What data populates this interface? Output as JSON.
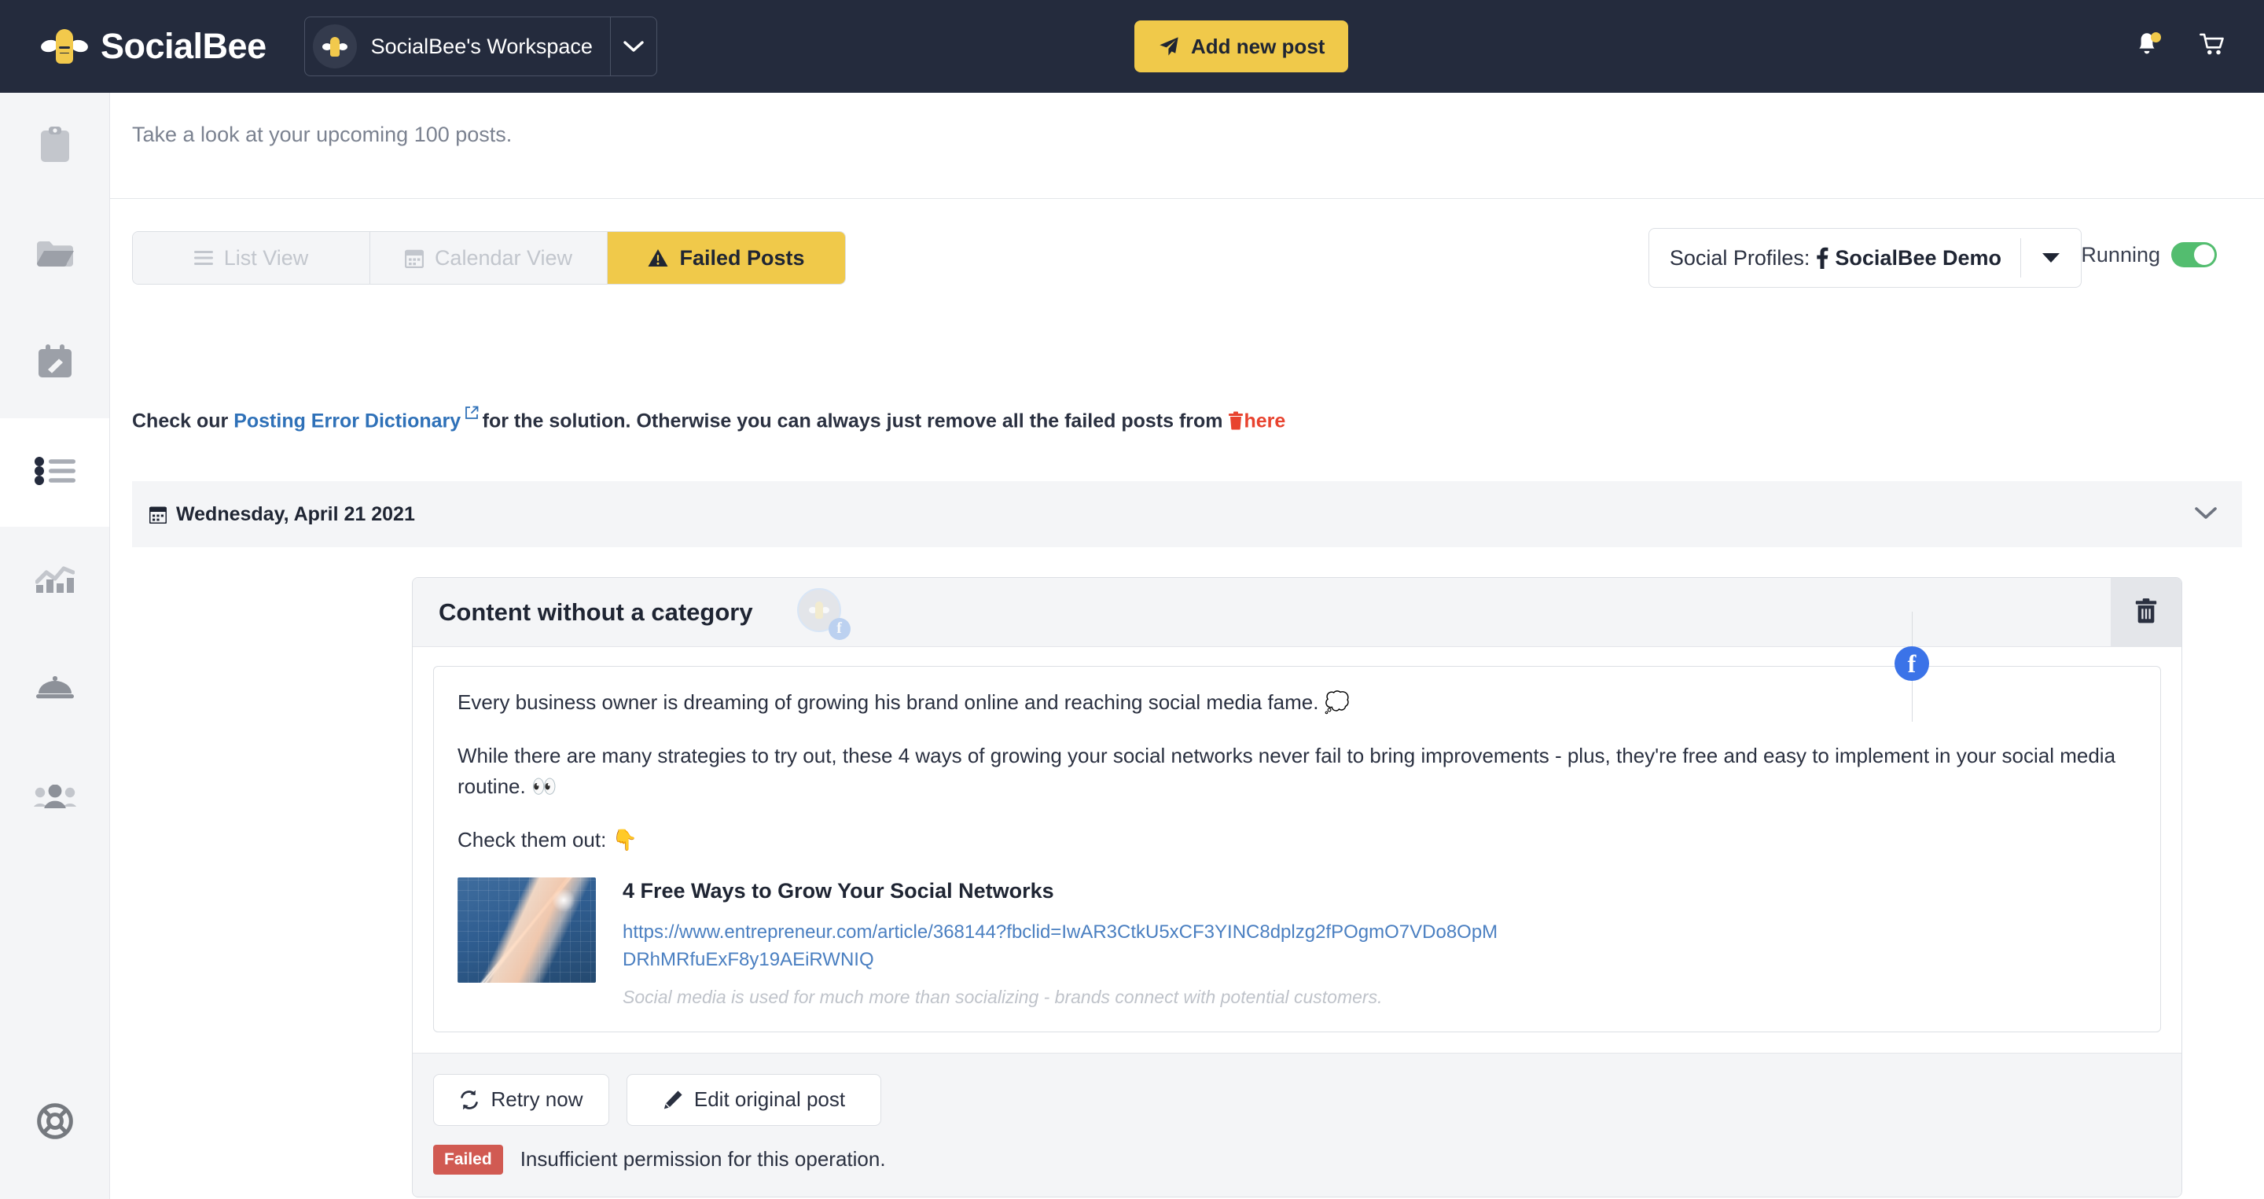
{
  "header": {
    "brand_name": "SocialBee",
    "brand_logo_icon": "bee-logo-icon",
    "workspace_name": "SocialBee's Workspace",
    "workspace_caret_icon": "chevron-down-icon",
    "add_post_label": "Add new post",
    "add_post_icon": "paper-plane-icon",
    "notifications_icon": "bell-icon",
    "cart_icon": "shopping-cart-icon",
    "notification_badge": ""
  },
  "sidebar": {
    "items": [
      {
        "name": "sidebar-item-content",
        "icon": "clipboard-icon"
      },
      {
        "name": "sidebar-item-categories",
        "icon": "folder-icon"
      },
      {
        "name": "sidebar-item-schedule",
        "icon": "calendar-edit-icon"
      },
      {
        "name": "sidebar-item-posts",
        "icon": "list-icon",
        "active": true
      },
      {
        "name": "sidebar-item-analytics",
        "icon": "chart-icon"
      },
      {
        "name": "sidebar-item-concierge",
        "icon": "dome-bell-icon"
      },
      {
        "name": "sidebar-item-audience",
        "icon": "users-icon"
      }
    ],
    "bottom_item": {
      "name": "sidebar-item-help",
      "icon": "life-ring-icon"
    }
  },
  "main": {
    "subtitle": "Take a look at your upcoming 100 posts.",
    "tabs": [
      {
        "label": "List View",
        "icon": "list-lines-icon",
        "active": false
      },
      {
        "label": "Calendar View",
        "icon": "calendar-icon",
        "active": false
      },
      {
        "label": "Failed Posts",
        "icon": "warning-triangle-icon",
        "active": true
      }
    ],
    "profiles": {
      "label": "Social Profiles:",
      "value": "SocialBee Demo",
      "value_icon": "facebook-f-icon",
      "caret_icon": "caret-down-icon"
    },
    "running": {
      "label": "Running",
      "state": "on"
    },
    "notice": {
      "prefix": "Check our ",
      "link_text": "Posting Error Dictionary",
      "link_icon": "external-link-icon",
      "middle": " for the solution. Otherwise you can always just remove all the failed posts from ",
      "trash_icon": "trash-icon",
      "here_text": "here"
    },
    "date_group": {
      "calendar_icon": "calendar-icon",
      "date_label": "Wednesday, April 21 2021",
      "collapse_icon": "chevron-down-icon"
    }
  },
  "post": {
    "title": "Content without a category",
    "avatar_icon": "bee-avatar-icon",
    "avatar_network_icon": "facebook-f-icon",
    "delete_icon": "trash-icon",
    "network_icon": "facebook-f-icon",
    "paragraphs": [
      "Every business owner is dreaming of growing his brand online and reaching social media fame. 💭",
      "While there are many strategies to try out, these 4 ways of growing your social networks never fail to bring improvements - plus, they're free and easy to implement in your social media routine. 👀",
      "Check them out: 👇"
    ],
    "link_preview": {
      "thumbnail_alt": "rising-line-chart-photo",
      "title": "4 Free Ways to Grow Your Social Networks",
      "url": "https://www.entrepreneur.com/article/368144?fbclid=IwAR3CtkU5xCF3YINC8dplzg2fPOgmO7VDo8OpMDRhMRfuExF8y19AEiRWNIQ",
      "description": "Social media is used for much more than socializing - brands connect with potential customers."
    },
    "actions": {
      "retry_label": "Retry now",
      "retry_icon": "refresh-icon",
      "edit_label": "Edit original post",
      "edit_icon": "pencil-icon"
    },
    "status": {
      "badge": "Failed",
      "message": "Insufficient permission for this operation."
    }
  },
  "colors": {
    "header_bg": "#242b3d",
    "accent_yellow": "#f0c94a",
    "link_blue": "#2f71b8",
    "danger_red": "#e8432f",
    "failed_badge": "#d15a52",
    "toggle_green": "#53bd6f",
    "facebook_blue": "#3b73e8"
  }
}
